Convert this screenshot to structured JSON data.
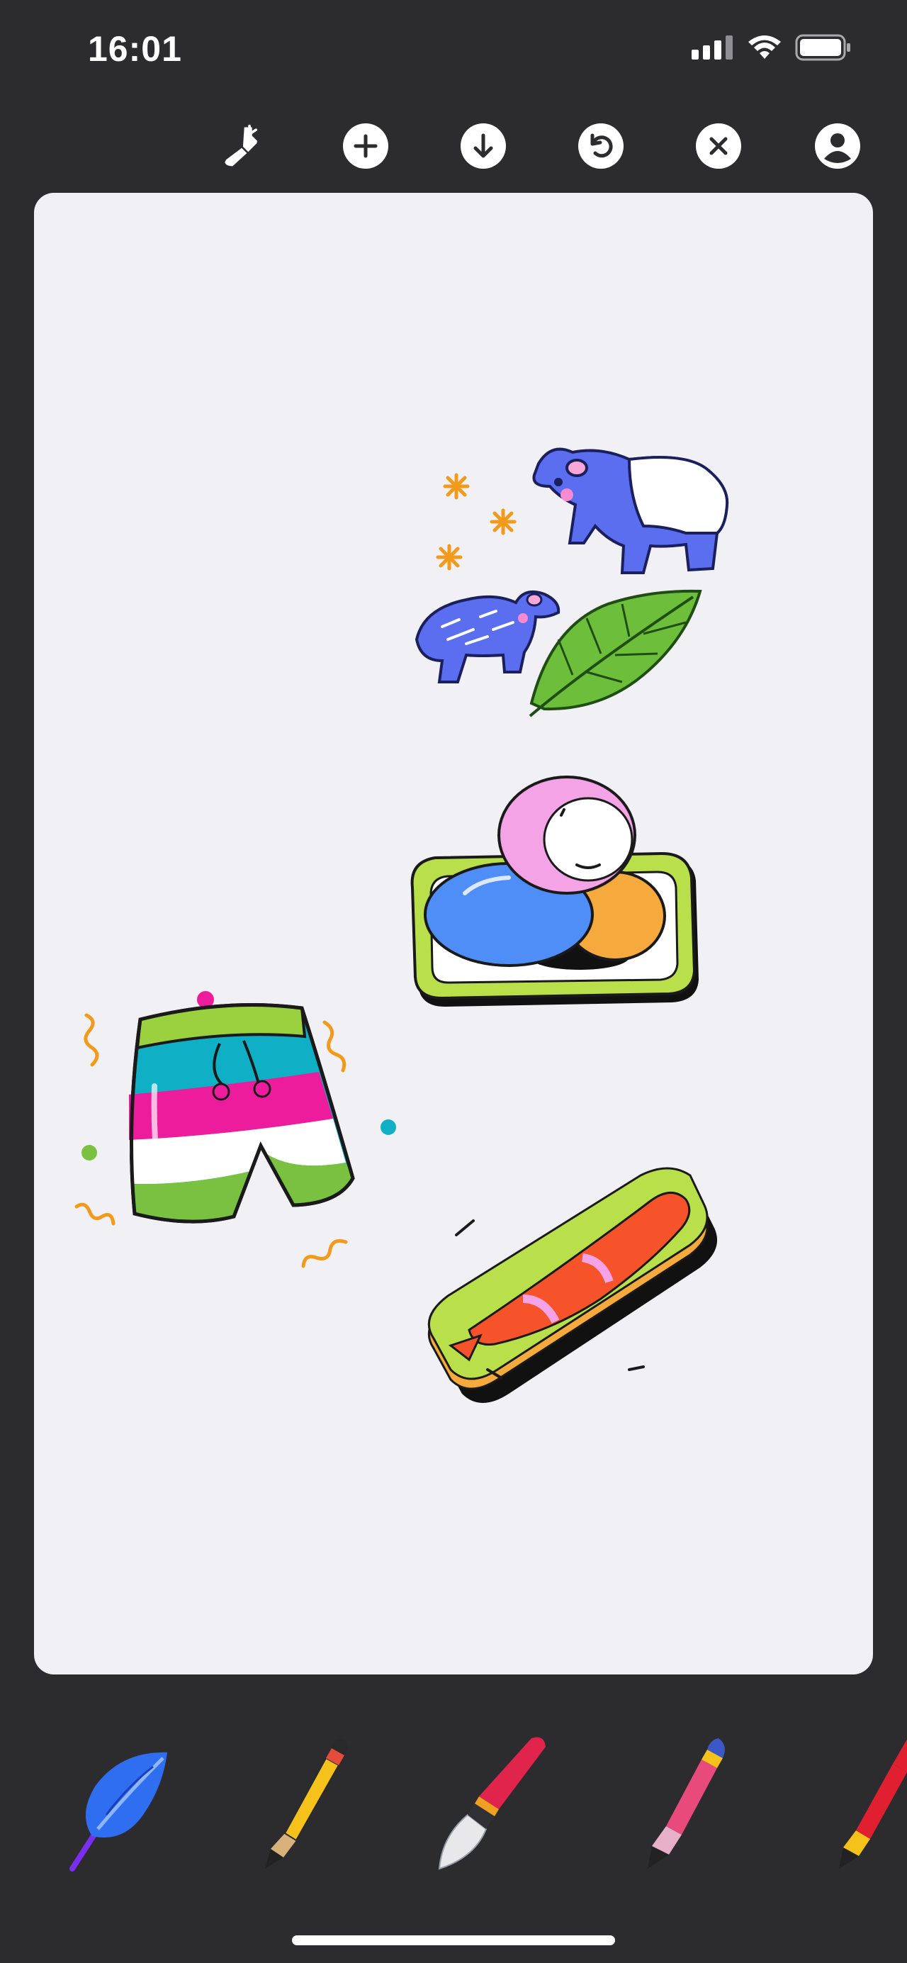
{
  "status_bar": {
    "time": "16:01"
  },
  "toolbar": {
    "buttons": [
      "brush-icon",
      "plus-icon",
      "download-icon",
      "undo-icon",
      "close-icon",
      "profile-icon"
    ]
  },
  "canvas": {
    "stickers": [
      "tapirs-sticker",
      "mochi-sticker",
      "swim-shorts-sticker",
      "sushi-sticker"
    ]
  },
  "drawing_tools": [
    "feather-pen",
    "yellow-pencil",
    "paintbrush",
    "pink-pencil",
    "red-pencil"
  ],
  "colors": {
    "app_background": "#2c2c2e",
    "canvas_background": "#f1f0f5",
    "icon_white": "#ffffff"
  }
}
